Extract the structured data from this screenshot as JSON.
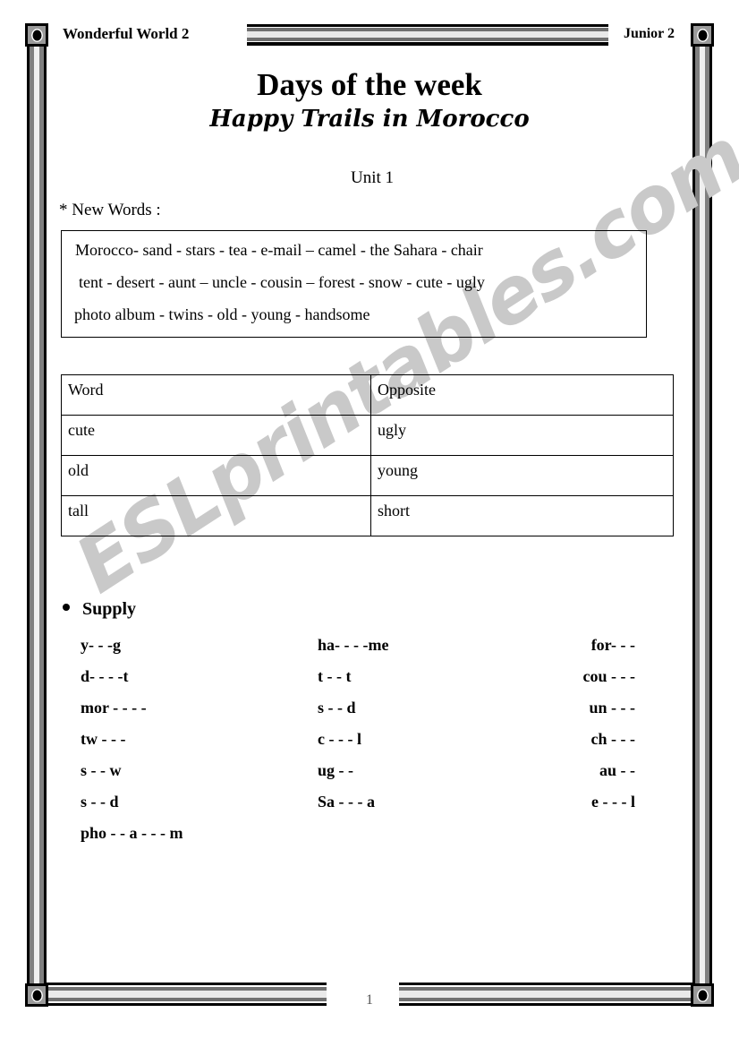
{
  "header": {
    "left_label": "Wonderful World 2",
    "right_label": "Junior  2"
  },
  "footer": {
    "page_number": "1"
  },
  "watermark": {
    "text": "ESLprintables.com"
  },
  "title": {
    "main": "Days of the week",
    "subtitle": "Happy Trails in Morocco"
  },
  "unit": {
    "label": "Unit 1"
  },
  "new_words": {
    "section_label": "* New Words :",
    "lines": [
      "Morocco- sand  - stars  -  tea -  e-mail – camel  -  the Sahara - chair",
      "tent - desert - aunt – uncle -  cousin – forest - snow - cute - ugly",
      "photo album - twins  - old  - young  - handsome"
    ]
  },
  "opposites_table": {
    "headers": [
      "Word",
      "Opposite"
    ],
    "rows": [
      [
        "cute",
        "ugly"
      ],
      [
        "old",
        "young"
      ],
      [
        "tall",
        "short"
      ]
    ]
  },
  "supply": {
    "heading": "Supply",
    "rows": [
      [
        "y- - -g",
        "ha- - - -me",
        "for- - -"
      ],
      [
        "d- - - -t",
        "t - - t",
        "cou - - -"
      ],
      [
        "mor - - - -",
        "s - - d",
        "un - - -"
      ],
      [
        "tw - - -",
        "c - - - l",
        "ch - - -"
      ],
      [
        "s - - w",
        "ug - -",
        "au - -"
      ],
      [
        "s - - d",
        "Sa - - - a",
        "e - - - l"
      ],
      [
        "pho - - a - - - m",
        "",
        ""
      ]
    ]
  }
}
